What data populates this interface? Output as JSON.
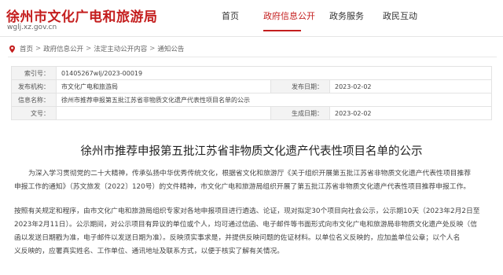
{
  "header": {
    "site_title": "徐州市文化广电和旅游局",
    "site_url": "wglj.xz.gov.cn",
    "nav": [
      {
        "label": "首页"
      },
      {
        "label": "政府信息公开"
      },
      {
        "label": "政务服务"
      },
      {
        "label": "政民互动"
      }
    ],
    "active_nav": "政府信息公开"
  },
  "breadcrumb": {
    "icon": "location-pin-icon",
    "items": [
      "首页",
      "政府信息公开",
      "法定主动公开内容",
      "通知公告"
    ],
    "separator": ">"
  },
  "meta": {
    "index_label": "索引号：",
    "index_value": "01405267wlj/2023-00019",
    "publisher_label": "发布机构：",
    "publisher_value": "市文化广电和旅游局",
    "date_label": "发布日期：",
    "date_value": "2023-02-02",
    "title_label": "信息名称：",
    "title_value": "徐州市推荐申报第五批江苏省非物质文化遗产代表性项目名单的公示",
    "docno_label": "文号：",
    "docno_value": "",
    "gen_date_label": "生成日期：",
    "gen_date_value": "2023-02-02"
  },
  "article": {
    "title": "徐州市推荐申报第五批江苏省非物质文化遗产代表性项目名单的公示",
    "p1_lines": [
      "为深入学习贯彻党的二十大精神，传承弘扬中华优秀传统文化，根据省文化和旅游厅《关于组织开展第五批江苏省非物质文化遗产代表性项目推荐",
      "申报工作的通知》（苏文旅发〔2022〕120号）的文件精神，市文化广电和旅游局组织开展了第五批江苏省非物质文化遗产代表性项目推荐申报工作。"
    ],
    "p2_lines": [
      "按照有关规定和程序，由市文化广电和旅游局组织专家对各地申报项目进行遴选、论证，现对拟定30个项目向社会公示，公示期10天（2023年2月2日至",
      "2023年2月11日）。公示期间，对公示项目有异议的单位或个人，均可通过信函、电子邮件等书面形式向市文化广电和旅游局非物质文化遗产处反映（信",
      "函以发送日期戳为准，电子邮件以发送日期为准）。反映须实事求是，并提供反映问题的佐证材料。以单位名义反映的，应加盖单位公章；以个人名",
      "义反映的，应署真实姓名、工作单位、通讯地址及联系方式，以便于核实了解有关情况。"
    ]
  },
  "colors": {
    "accent": "#c41e1e",
    "label_bg": "#f3f3f3",
    "border": "#e3e3e3"
  }
}
